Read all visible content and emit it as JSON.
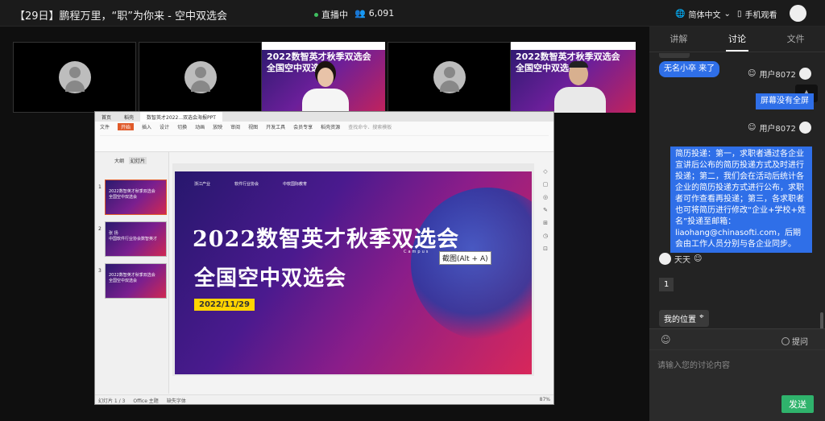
{
  "header": {
    "title": "【29日】鹏程万里，“职”为你来 - 空中双选会",
    "live_label": "直播中",
    "viewer_count": "6,091",
    "language": "简体中文",
    "mobile_label": "手机观看"
  },
  "video": {
    "banner_line1": "2022数智英才秋季双选会",
    "banner_line2": "全国空中双选会"
  },
  "wps": {
    "tabs": [
      "首页",
      "稻壳",
      "数智英才2022...双选会海报PPT"
    ],
    "menu": [
      "文件",
      "开始",
      "插入",
      "设计",
      "切换",
      "动画",
      "放映",
      "审阅",
      "视图",
      "开发工具",
      "会员专享",
      "稻壳资源"
    ],
    "active_menu": "开始",
    "search_placeholder": "查找命令、搜索模板",
    "outline_tabs": [
      "大纲",
      "幻灯片"
    ],
    "thumbs": [
      {
        "n": "1",
        "line1": "2022数智英才秋季双选会",
        "line2": "全国空中双选会"
      },
      {
        "n": "2",
        "line1": "张 扬",
        "line2": "中国软件行业协会数智英才"
      },
      {
        "n": "3",
        "line1": "2022数智英才秋季双选会",
        "line2": "全国空中双选会"
      }
    ],
    "slide": {
      "logo1": "浙江产业",
      "logo2": "软件行业协会",
      "logo3": "中软国际教育",
      "title1": "2022数智英才秋季双选会",
      "title2": "全国空中双选会",
      "date": "2022/11/29",
      "subtext": "Campus"
    },
    "tooltip": "截图(Alt + A)",
    "status": {
      "page": "幻灯片 1 / 3",
      "theme": "Office 主题",
      "font": "缺失字体",
      "zoom": "87%"
    }
  },
  "sidebar": {
    "tabs": [
      "讲解",
      "讨论",
      "文件"
    ],
    "active_tab": "讨论",
    "messages": {
      "join_notice": "无名小卒 来了",
      "user1": "用户8072",
      "bubble1": "屏幕没有全屏",
      "user2": "用户8072",
      "bubble2": "简历投递：第一，求职者通过各企业宣讲后公布的简历投递方式及时进行投递；第二，我们会在活动后统计各企业的简历投递方式进行公布，求职者可作查看再投递；第三，各求职者也可将简历进行修改“企业+学校+姓名”投递至邮箱：liaohang@chinasofti.com，后期会由工作人员分别与各企业同步。",
      "user3": "天天",
      "bubble3": "1",
      "location": "我的位置"
    },
    "input": {
      "placeholder": "请输入您的讨论内容",
      "ask_label": "提问",
      "send_label": "发送"
    }
  }
}
